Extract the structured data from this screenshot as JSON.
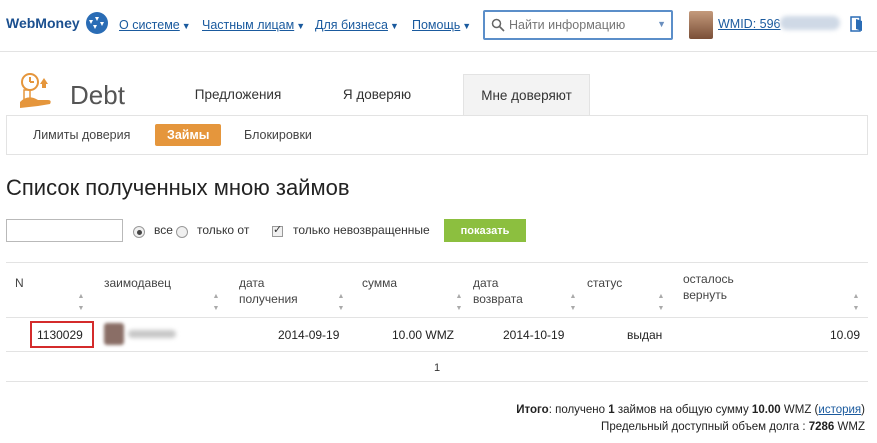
{
  "header": {
    "logo": "WebMoney",
    "nav": [
      {
        "label": "О системе"
      },
      {
        "label": "Частным лицам"
      },
      {
        "label": "Для бизнеса"
      },
      {
        "label": "Помощь"
      }
    ],
    "search_placeholder": "Найти информацию",
    "wmid_label": "WMID: 596"
  },
  "app": {
    "title": "Debt",
    "tabs": [
      {
        "label": "Предложения"
      },
      {
        "label": "Я доверяю"
      },
      {
        "label": "Мне доверяют",
        "active": true
      }
    ],
    "subtabs": [
      {
        "label": "Лимиты доверия"
      },
      {
        "label": "Займы",
        "active": true
      },
      {
        "label": "Блокировки"
      }
    ]
  },
  "page": {
    "title": "Список полученных мною займов"
  },
  "filter": {
    "input_value": "",
    "radio_all": "все",
    "radio_from": "только от",
    "checkbox_unreturned": "только невозвращенные",
    "show_button": "показать"
  },
  "table": {
    "columns": {
      "n": "N",
      "lender": "заимодавец",
      "received_1": "дата",
      "received_2": "получения",
      "amount": "сумма",
      "return_1": "дата",
      "return_2": "возврата",
      "status": "статус",
      "remaining_1": "осталось",
      "remaining_2": "вернуть"
    },
    "rows": [
      {
        "id": "1130029",
        "received": "2014-09-19",
        "amount": "10.00 WMZ",
        "return_date": "2014-10-19",
        "status": "выдан",
        "remaining": "10.09"
      }
    ],
    "page": "1"
  },
  "totals": {
    "label": "Итого",
    "text1": ": получено ",
    "count": "1",
    "text2": " займов на общую сумму ",
    "sum": "10.00",
    "currency": " WMZ (",
    "history_link": "история",
    "text3": ")",
    "limit_label": "Предельный доступный объем долга : ",
    "limit_value": "7286",
    "limit_currency": " WMZ"
  },
  "colors": {
    "accent_orange": "#e5963c",
    "button_green": "#8cbf3f",
    "link_blue": "#1a5a9e",
    "highlight_red": "#d42b2b"
  }
}
